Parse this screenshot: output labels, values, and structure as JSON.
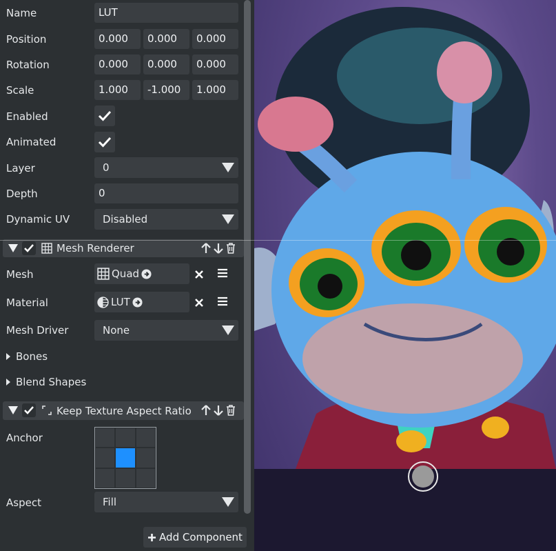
{
  "transform": {
    "name_label": "Name",
    "name_value": "LUT",
    "position_label": "Position",
    "position": [
      "0.000",
      "0.000",
      "0.000"
    ],
    "rotation_label": "Rotation",
    "rotation": [
      "0.000",
      "0.000",
      "0.000"
    ],
    "scale_label": "Scale",
    "scale": [
      "1.000",
      "-1.000",
      "1.000"
    ],
    "enabled_label": "Enabled",
    "enabled": true,
    "animated_label": "Animated",
    "animated": true,
    "layer_label": "Layer",
    "layer_value": "0",
    "depth_label": "Depth",
    "depth_value": "0",
    "dynamic_uv_label": "Dynamic UV",
    "dynamic_uv_value": "Disabled"
  },
  "mesh_renderer": {
    "title": "Mesh Renderer",
    "mesh_label": "Mesh",
    "mesh_value": "Quad",
    "material_label": "Material",
    "material_value": "LUT",
    "mesh_driver_label": "Mesh Driver",
    "mesh_driver_value": "None",
    "bones_label": "Bones",
    "blend_shapes_label": "Blend Shapes"
  },
  "keep_aspect": {
    "title": "Keep Texture Aspect Ratio",
    "anchor_label": "Anchor",
    "anchor_selected": "center",
    "aspect_label": "Aspect",
    "aspect_value": "Fill"
  },
  "footer": {
    "add_component_label": "Add Component"
  },
  "colors": {
    "panel_bg": "#2c3033",
    "field_bg": "#3a3e42",
    "accent": "#1e90ff"
  }
}
